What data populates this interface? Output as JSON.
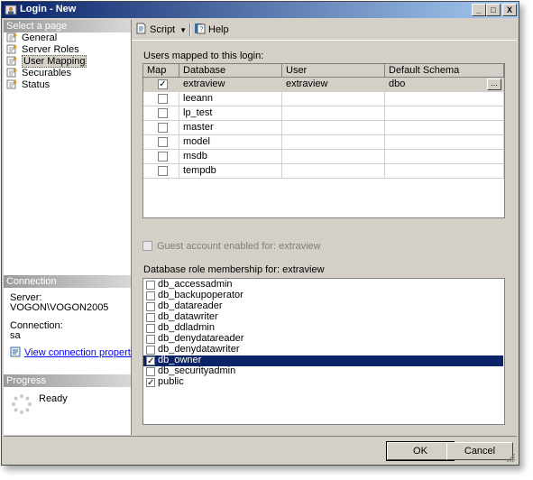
{
  "window": {
    "title": "Login - New",
    "minimize_glyph": "_",
    "maximize_glyph": "□",
    "close_glyph": "X"
  },
  "sidebar": {
    "select_page_header": "Select a page",
    "items": [
      {
        "label": "General",
        "icon": "page-icon"
      },
      {
        "label": "Server Roles",
        "icon": "page-icon"
      },
      {
        "label": "User Mapping",
        "icon": "page-icon",
        "selected": true
      },
      {
        "label": "Securables",
        "icon": "page-icon"
      },
      {
        "label": "Status",
        "icon": "page-icon"
      }
    ],
    "connection_header": "Connection",
    "server_label": "Server:",
    "server_value": "VOGON\\VOGON2005",
    "connection_label": "Connection:",
    "connection_value": "sa",
    "view_props_link": "View connection properties",
    "progress_header": "Progress",
    "progress_status": "Ready"
  },
  "toolbar": {
    "script_label": "Script",
    "help_label": "Help"
  },
  "mapping": {
    "label": "Users mapped to this login:",
    "columns": [
      "Map",
      "Database",
      "User",
      "Default Schema"
    ],
    "rows": [
      {
        "map": true,
        "database": "extraview",
        "user": "extraview",
        "schema": "dbo"
      },
      {
        "map": false,
        "database": "leeann",
        "user": "",
        "schema": ""
      },
      {
        "map": false,
        "database": "lp_test",
        "user": "",
        "schema": ""
      },
      {
        "map": false,
        "database": "master",
        "user": "",
        "schema": ""
      },
      {
        "map": false,
        "database": "model",
        "user": "",
        "schema": ""
      },
      {
        "map": false,
        "database": "msdb",
        "user": "",
        "schema": ""
      },
      {
        "map": false,
        "database": "tempdb",
        "user": "",
        "schema": ""
      }
    ],
    "ellipsis": "..."
  },
  "guest": {
    "label": "Guest account enabled for: extraview",
    "checked": false
  },
  "roles": {
    "label": "Database role membership for: extraview",
    "items": [
      {
        "name": "db_accessadmin",
        "checked": false
      },
      {
        "name": "db_backupoperator",
        "checked": false
      },
      {
        "name": "db_datareader",
        "checked": false
      },
      {
        "name": "db_datawriter",
        "checked": false
      },
      {
        "name": "db_ddladmin",
        "checked": false
      },
      {
        "name": "db_denydatareader",
        "checked": false
      },
      {
        "name": "db_denydatawriter",
        "checked": false
      },
      {
        "name": "db_owner",
        "checked": true,
        "selected": true
      },
      {
        "name": "db_securityadmin",
        "checked": false
      },
      {
        "name": "public",
        "checked": true
      }
    ]
  },
  "buttons": {
    "ok": "OK",
    "cancel": "Cancel"
  },
  "colors": {
    "title_bar": "#0a246a",
    "selection": "#0a246a",
    "link": "#0000ff"
  }
}
